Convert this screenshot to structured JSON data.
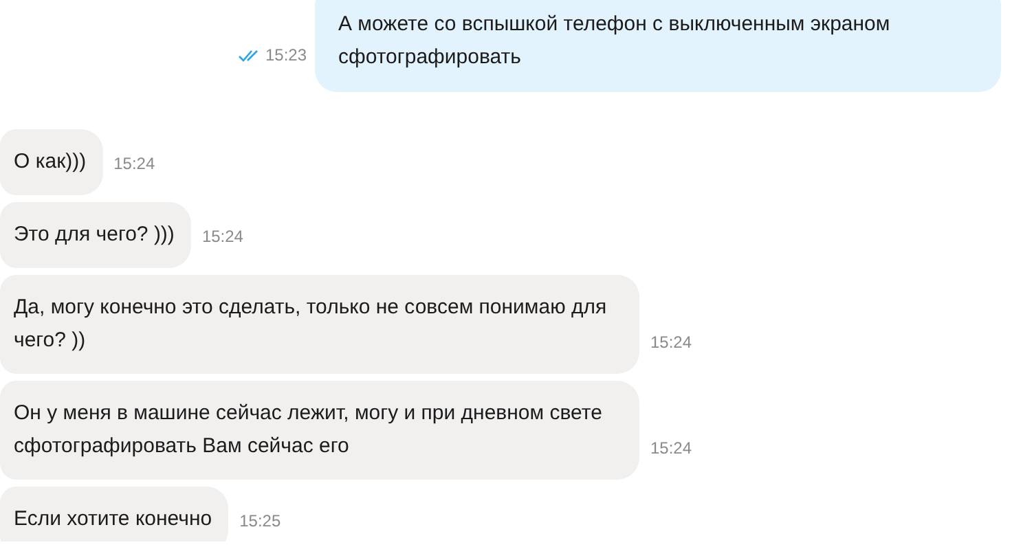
{
  "messages": [
    {
      "kind": "outgoing",
      "text": "А можете со вспышкой телефон с выключенным экраном сфотографировать",
      "time": "15:23",
      "read": true
    },
    {
      "kind": "incoming",
      "text": "О как)))",
      "time": "15:24"
    },
    {
      "kind": "incoming",
      "text": "Это для чего? )))",
      "time": "15:24"
    },
    {
      "kind": "incoming",
      "text": "Да, могу конечно это сделать, только не совсем понимаю для чего? ))",
      "time": "15:24"
    },
    {
      "kind": "incoming",
      "text": "Он у меня в машине сейчас лежит, могу и при дневном свете сфотографировать Вам сейчас его",
      "time": "15:24"
    },
    {
      "kind": "incoming",
      "text": "Если хотите конечно",
      "time": "15:25"
    }
  ]
}
